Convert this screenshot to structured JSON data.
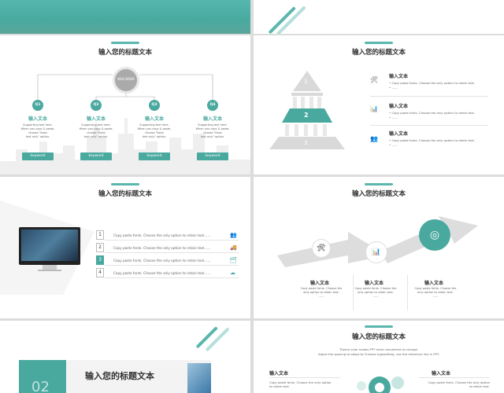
{
  "common": {
    "slide_title": "输入您的标题文本",
    "sub_title": "输入文本",
    "keyword": "keyword",
    "accent": "#4aa99f"
  },
  "slide3": {
    "center_value": "666,666K",
    "nodes": [
      {
        "label": "Q1",
        "title": "输入文本",
        "line1": "Supporting text here.",
        "line2": "When you copy & paste, choose \"keep",
        "line3": "text only\" option.",
        "btn": "keyword"
      },
      {
        "label": "Q2",
        "title": "输入文本",
        "line1": "Supporting text here.",
        "line2": "When you copy & paste, choose \"keep",
        "line3": "text only\" option.",
        "btn": "keyword"
      },
      {
        "label": "Q3",
        "title": "输入文本",
        "line1": "Supporting text here.",
        "line2": "When you copy & paste, choose \"keep",
        "line3": "text only\" option.",
        "btn": "keyword"
      },
      {
        "label": "Q4",
        "title": "输入文本",
        "line1": "Supporting text here.",
        "line2": "When you copy & paste, choose \"keep",
        "line3": "text only\" option.",
        "btn": "keyword"
      }
    ]
  },
  "slide4": {
    "levels": [
      "1",
      "2",
      "3"
    ],
    "items": [
      {
        "title": "输入文本",
        "text": "Copy paste fonts. Choose the only option to retain text.",
        "dots": "……"
      },
      {
        "title": "输入文本",
        "text": "Copy paste fonts. Choose the only option to retain text.",
        "dots": "……"
      },
      {
        "title": "输入文本",
        "text": "Copy paste fonts. Choose the only option to retain text.",
        "dots": "……"
      }
    ]
  },
  "slide5": {
    "rows": [
      {
        "num": "1",
        "text": "Copy paste fonts. Choose the only option to retain text……"
      },
      {
        "num": "2",
        "text": "Copy paste fonts. Choose the only option to retain text……"
      },
      {
        "num": "3",
        "text": "Copy paste fonts. Choose the only option to retain text……"
      },
      {
        "num": "4",
        "text": "Copy paste fonts. Choose the only option to retain text……"
      }
    ]
  },
  "slide6": {
    "steps": [
      {
        "title": "输入文本",
        "line1": "Copy paste fonts. Choose the",
        "line2": "only option to retain text.",
        "dots": "……"
      },
      {
        "title": "输入文本",
        "line1": "Copy paste fonts. Choose the",
        "line2": "only option to retain text.",
        "dots": "……"
      },
      {
        "title": "输入文本",
        "line1": "Copy paste fonts. Choose the",
        "line2": "only option to retain text.",
        "dots": "……"
      }
    ]
  },
  "slide7": {
    "number": "02",
    "title": "输入您的标题文本"
  },
  "slide8": {
    "intro1": "Theme color makes PPT more convenient to change.",
    "intro2": "Adjust the spacing to adapt to Chinese typesetting, use the reference line in PPT.",
    "left": {
      "title": "输入文本",
      "line1": "Copy paste fonts. Choose the only option",
      "line2": "to retain text."
    },
    "right": {
      "title": "输入文本",
      "line1": "Copy paste fonts. Choose the only option",
      "line2": "to retain text."
    }
  }
}
